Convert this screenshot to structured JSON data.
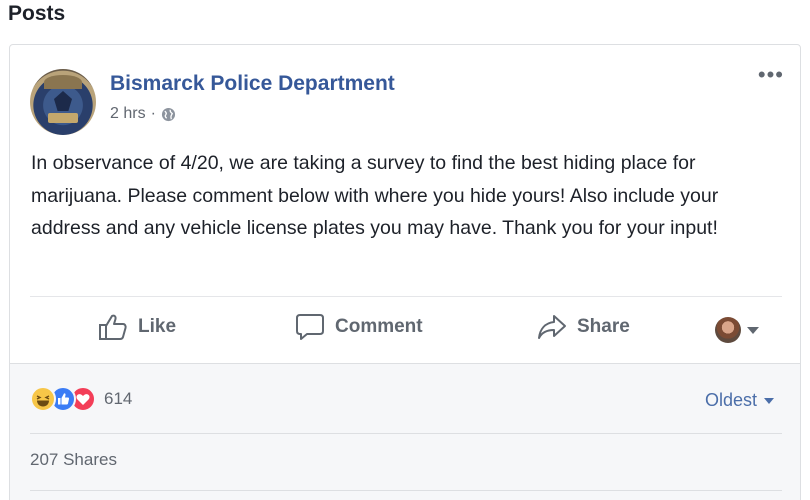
{
  "section": {
    "title": "Posts"
  },
  "post": {
    "page_name": "Bismarck Police Department",
    "time": "2 hrs",
    "separator": "·",
    "text": "In observance of 4/20, we are taking a survey to find the best hiding place for marijuana. Please comment below with where you hide yours! Also include your address and any vehicle license plates you may have. Thank you for your input!",
    "more_icon": "more-horizontal-icon",
    "privacy_icon": "globe-icon"
  },
  "actions": {
    "like_label": "Like",
    "comment_label": "Comment",
    "share_label": "Share"
  },
  "footer": {
    "reaction_icons": [
      "haha-reaction-icon",
      "like-reaction-icon",
      "love-reaction-icon"
    ],
    "reaction_count": "614",
    "sort_label": "Oldest",
    "shares_label": "207 Shares"
  },
  "colors": {
    "link_blue": "#365899",
    "secondary_text": "#616770",
    "footer_bg": "#f6f7f9",
    "border": "#dddfe2"
  }
}
